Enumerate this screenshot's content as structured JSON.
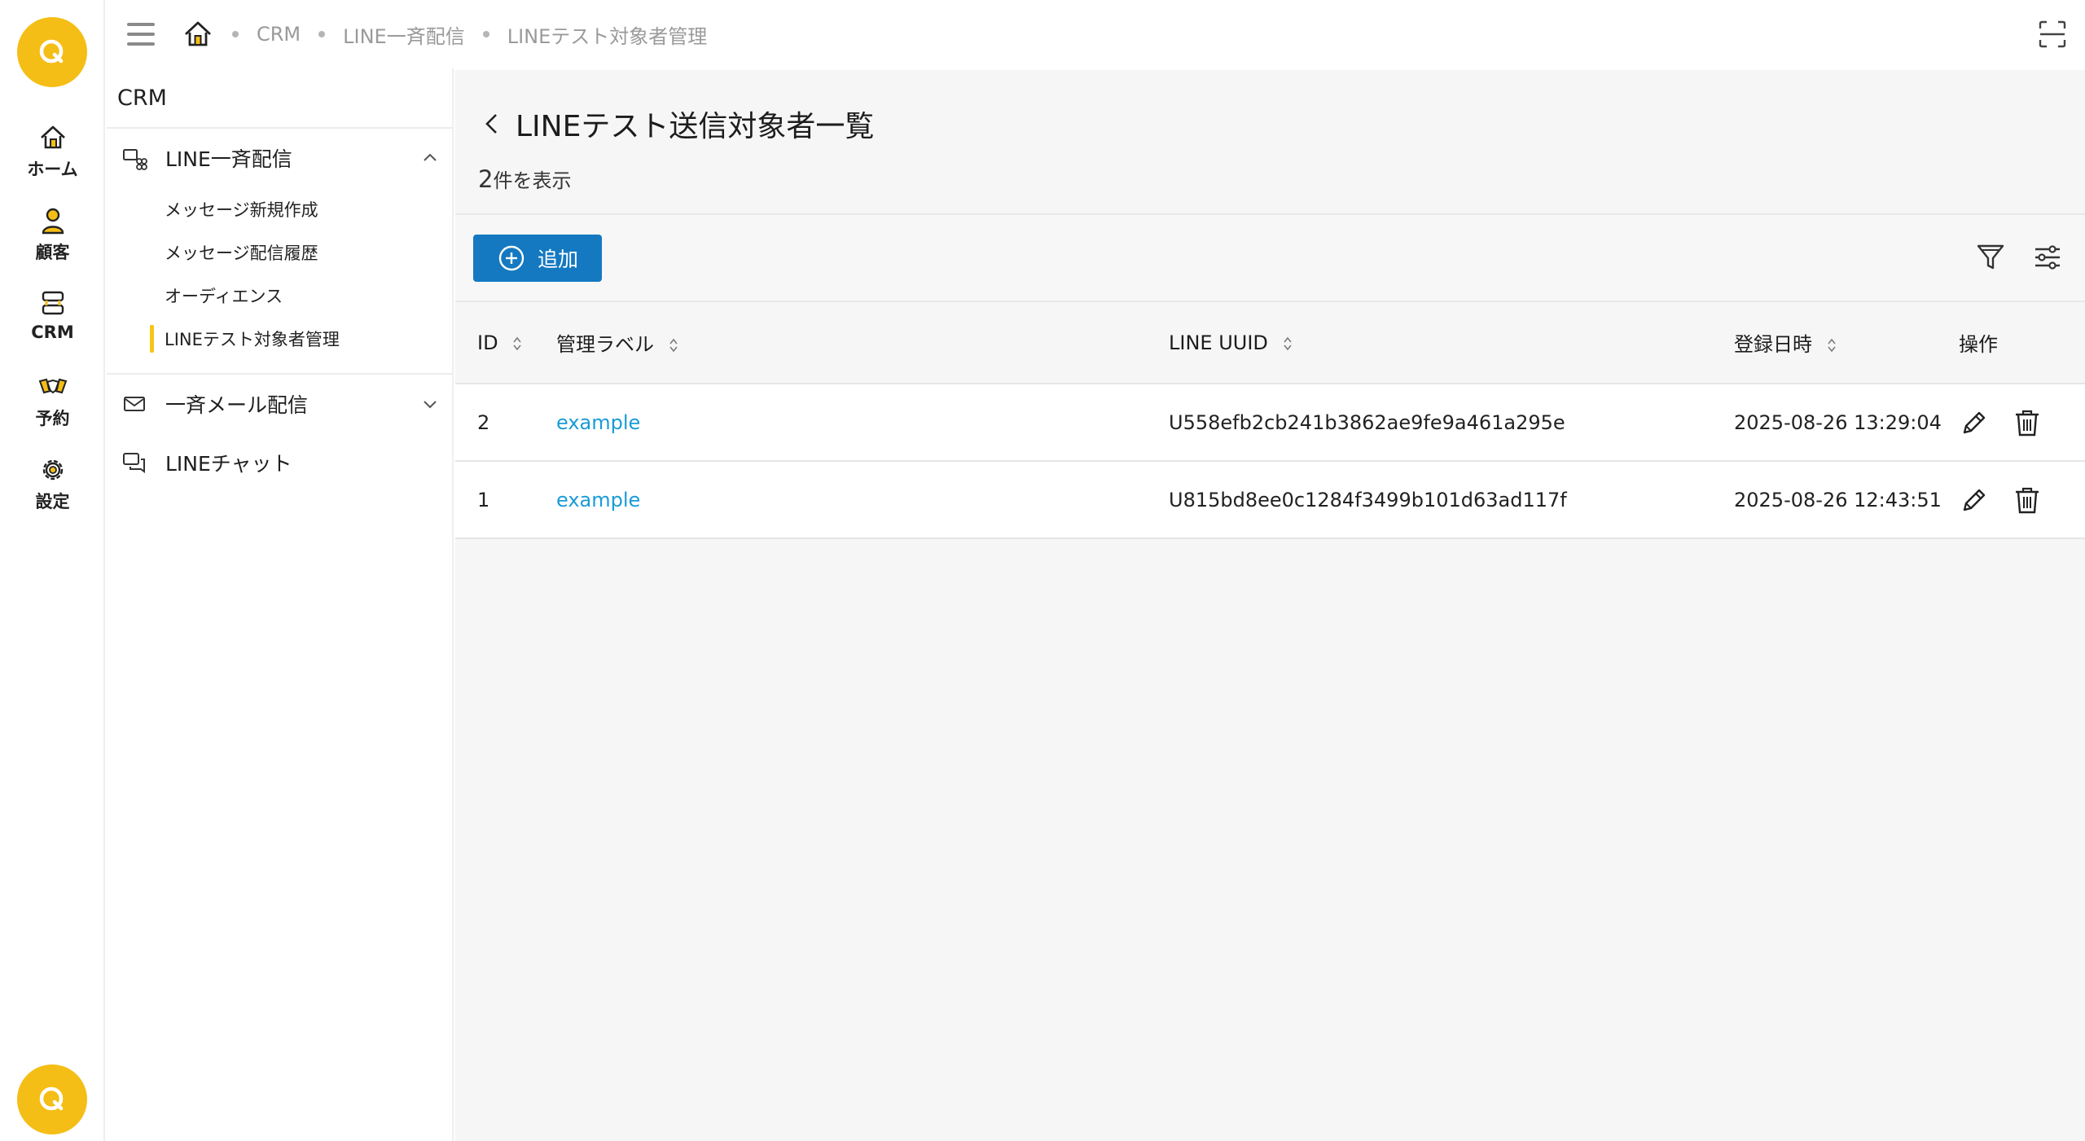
{
  "rail": {
    "items": [
      {
        "label": "ホーム",
        "icon": "home-icon"
      },
      {
        "label": "顧客",
        "icon": "user-icon"
      },
      {
        "label": "CRM",
        "icon": "crm-icon"
      },
      {
        "label": "予約",
        "icon": "handshake-icon"
      },
      {
        "label": "設定",
        "icon": "gear-icon"
      }
    ],
    "accent": "#f5be16"
  },
  "breadcrumb": [
    "CRM",
    "LINE一斉配信",
    "LINEテスト対象者管理"
  ],
  "submenu": {
    "title": "CRM",
    "groups": [
      {
        "label": "LINE一斉配信",
        "expanded": true,
        "items": [
          {
            "label": "メッセージ新規作成"
          },
          {
            "label": "メッセージ配信履歴"
          },
          {
            "label": "オーディエンス"
          },
          {
            "label": "LINEテスト対象者管理",
            "active": true
          }
        ]
      },
      {
        "label": "一斉メール配信",
        "expanded": false
      },
      {
        "label": "LINEチャット"
      }
    ]
  },
  "page": {
    "title": "LINEテスト送信対象者一覧",
    "count_number": "2",
    "count_suffix": "件を表示",
    "add_label": "追加",
    "add_color": "#1479c1"
  },
  "table": {
    "columns": [
      "ID",
      "管理ラベル",
      "LINE UUID",
      "登録日時",
      "操作"
    ],
    "rows": [
      {
        "id": "2",
        "label": "example",
        "uuid": "U558efb2cb241b3862ae9fe9a461a295e",
        "date": "2025-08-26 13:29:04"
      },
      {
        "id": "1",
        "label": "example",
        "uuid": "U815bd8ee0c1284f3499b101d63ad117f",
        "date": "2025-08-26 12:43:51"
      }
    ],
    "link_color": "#1a9bd7"
  }
}
